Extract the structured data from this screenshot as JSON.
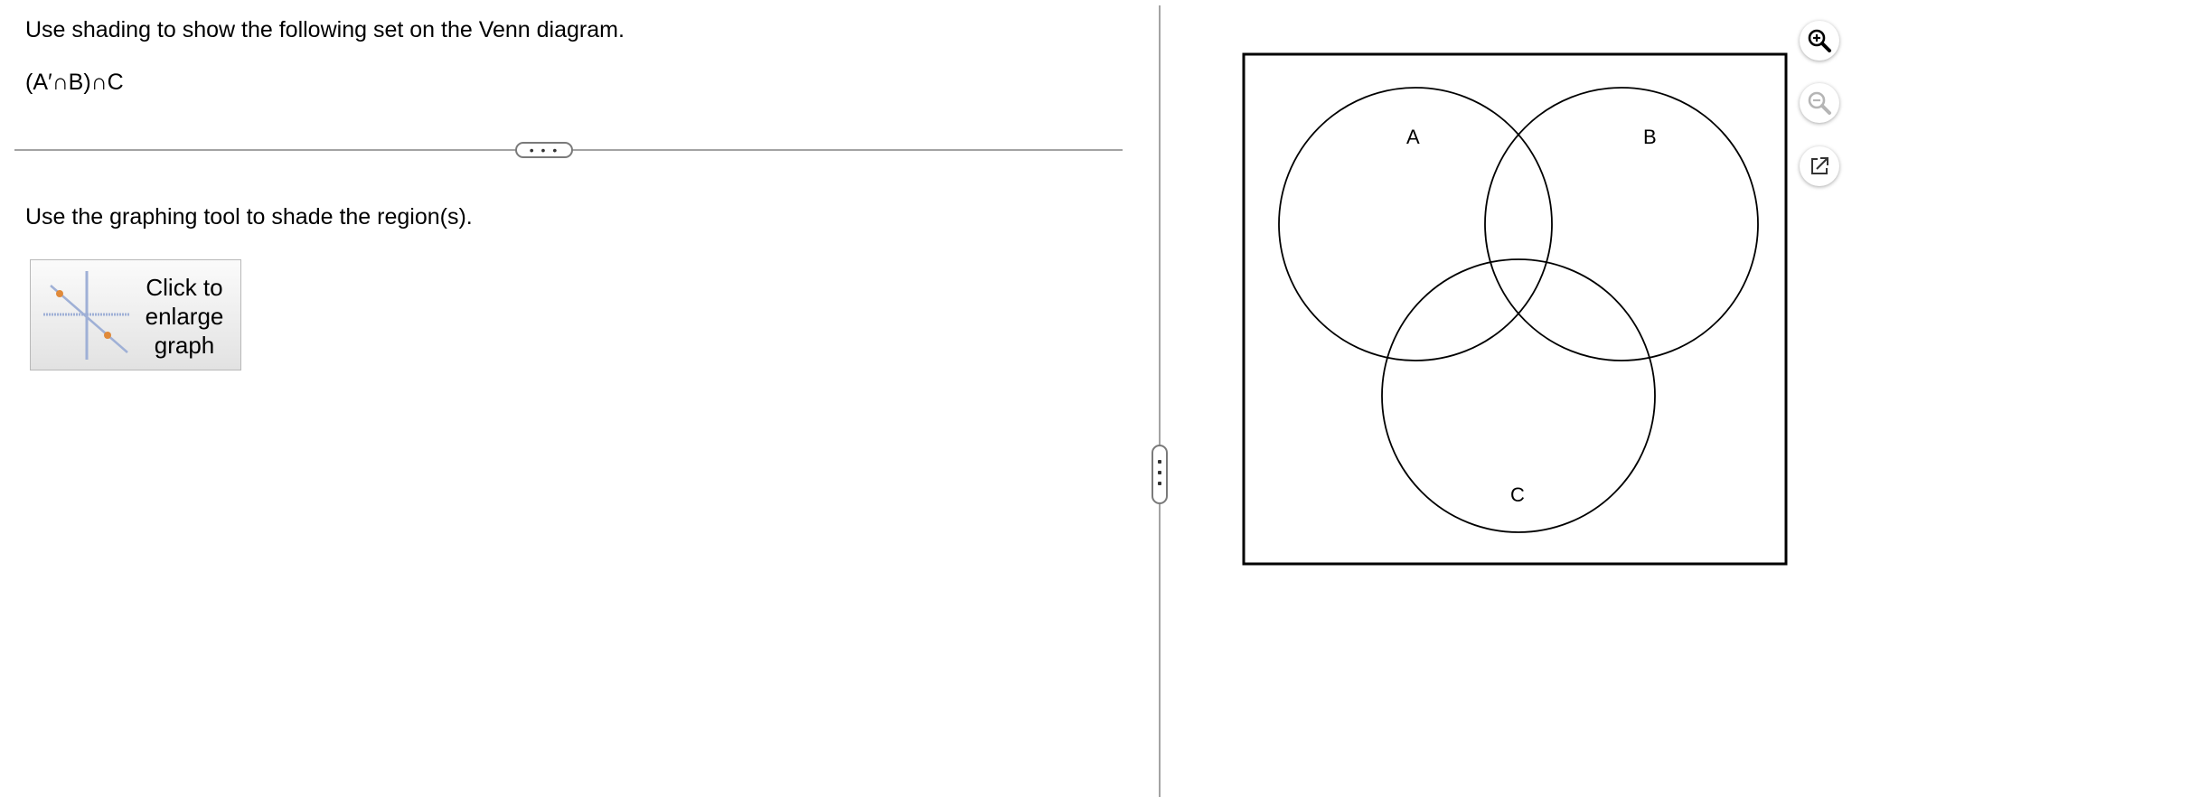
{
  "question": {
    "instruction": "Use shading to show the following set on the Venn diagram.",
    "expression": "(A′∩B)∩C"
  },
  "answer": {
    "tool_instruction": "Use the graphing tool to shade the region(s).",
    "enlarge_button": {
      "line1": "Click to",
      "line2": "enlarge",
      "line3": "graph"
    }
  },
  "divider": {
    "horizontal_handle_label": "• • •"
  },
  "venn": {
    "labels": {
      "a": "A",
      "b": "B",
      "c": "C"
    }
  },
  "toolbar": {
    "zoom_in_icon": "zoom-in-icon",
    "zoom_out_icon": "zoom-out-icon",
    "popout_icon": "popout-icon"
  },
  "colors": {
    "divider": "#a3a3a3",
    "zoom_out_disabled": "#b5b5b5",
    "thumb_axis": "#9fb0d6",
    "thumb_point": "#e08a3a"
  }
}
